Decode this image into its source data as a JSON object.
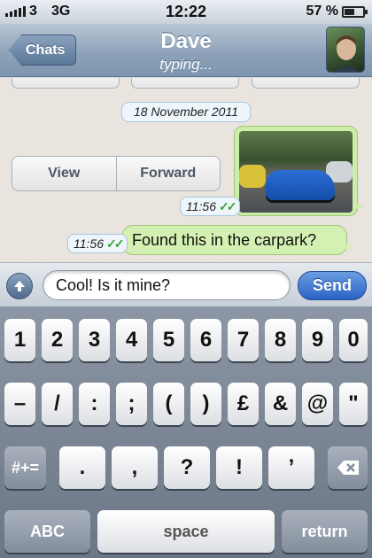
{
  "status_bar": {
    "carrier": "3",
    "network": "3G",
    "time": "12:22",
    "battery_percent": "57 %",
    "battery_level": 0.57
  },
  "nav": {
    "back_label": "Chats",
    "contact_name": "Dave",
    "status": "typing..."
  },
  "chat": {
    "date_label": "18 November 2011",
    "media_actions": [
      "View",
      "Forward"
    ],
    "image_time": "11:56",
    "text_time": "11:56",
    "text_message": "Found this in the carpark?",
    "ticks": "✓✓"
  },
  "input": {
    "value": "Cool! Is it mine?",
    "send_label": "Send"
  },
  "keyboard": {
    "row1": [
      "1",
      "2",
      "3",
      "4",
      "5",
      "6",
      "7",
      "8",
      "9",
      "0"
    ],
    "row2": [
      "–",
      "/",
      ":",
      ";",
      "(",
      ")",
      "£",
      "&",
      "@",
      "\""
    ],
    "row3_left": "#+=",
    "row3": [
      ".",
      ",",
      "?",
      "!",
      "’"
    ],
    "row3_right_icon": "backspace-icon",
    "abc_label": "ABC",
    "space_label": "space",
    "return_label": "return"
  },
  "colors": {
    "outgoing_bubble": "#d4f0b3",
    "send_button": "#2a63c5",
    "read_ticks": "#3aa335"
  }
}
